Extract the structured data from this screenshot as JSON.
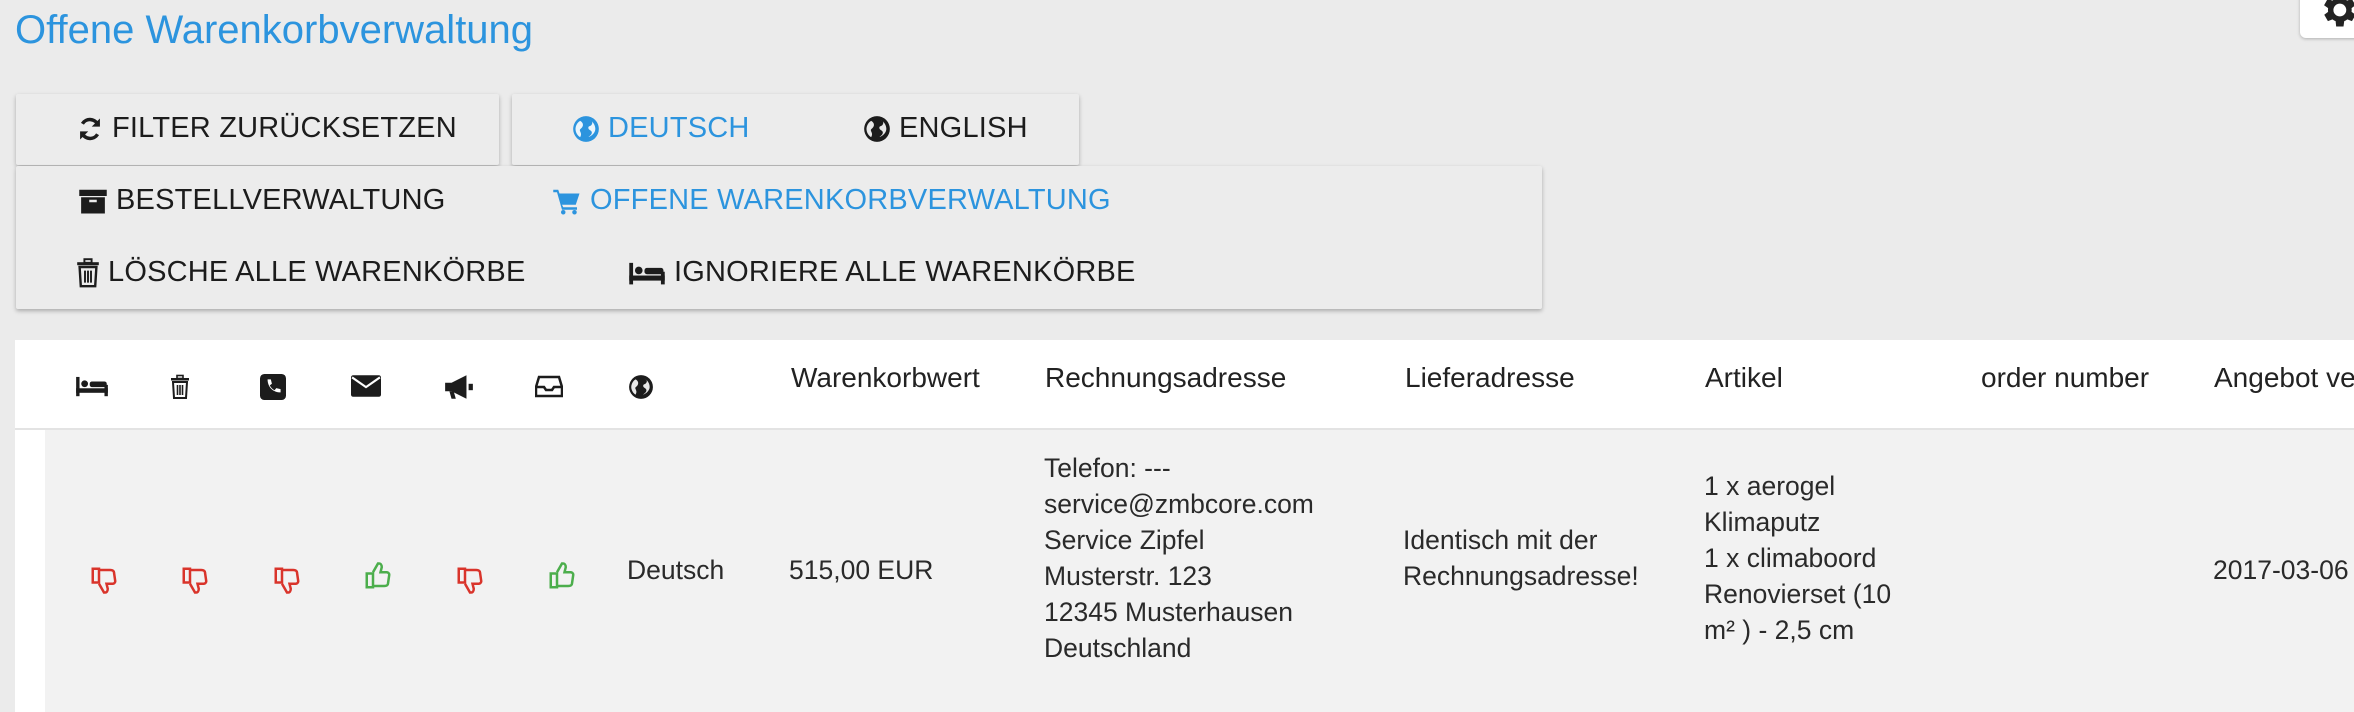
{
  "page": {
    "title": "Offene Warenkorbverwaltung"
  },
  "icons": {
    "gear": "gear-icon"
  },
  "toolbar1": {
    "reset_label": "FILTER ZURÜCKSETZEN",
    "lang_de_label": "DEUTSCH",
    "lang_en_label": "ENGLISH"
  },
  "toolbar2": {
    "orders_label": "BESTELLVERWALTUNG",
    "open_carts_label": "OFFENE WARENKORBVERWALTUNG",
    "delete_all_label": "LÖSCHE ALLE WARENKÖRBE",
    "ignore_all_label": "IGNORIERE ALLE WARENKÖRBE"
  },
  "colors": {
    "accent": "#2c94de",
    "thumb_down": "#d9342b",
    "thumb_up": "#4cae4c"
  },
  "table": {
    "icon_columns": [
      "bed-icon",
      "trash-icon",
      "phone-icon",
      "envelope-icon",
      "bullhorn-icon",
      "inbox-icon",
      "globe-icon"
    ],
    "headers": {
      "value": "Warenkorbwert",
      "billing": "Rechnungsadresse",
      "shipping": "Lieferadresse",
      "items": "Artikel",
      "order_number": "order number",
      "offer": "Angebot ve"
    },
    "rows": [
      {
        "status_icons": [
          "thumbs-down",
          "thumbs-down",
          "thumbs-down",
          "thumbs-up",
          "thumbs-down",
          "thumbs-up"
        ],
        "language": "Deutsch",
        "value": "515,00 EUR",
        "billing": {
          "l1": "Telefon: ---",
          "l2": "service@zmbcore.com",
          "l3": "Service Zipfel",
          "l4": "Musterstr. 123",
          "l5": "12345 Musterhausen",
          "l6": "Deutschland"
        },
        "shipping": {
          "l1": "Identisch mit der",
          "l2": "Rechnungsadresse!"
        },
        "items": {
          "l1": "1 x aerogel",
          "l2": "Klimaputz",
          "l3": "1 x climaboord",
          "l4": "Renovierset (10",
          "l5": "m² ) - 2,5 cm"
        },
        "order_number": "",
        "offer": "2017-03-06"
      }
    ]
  }
}
